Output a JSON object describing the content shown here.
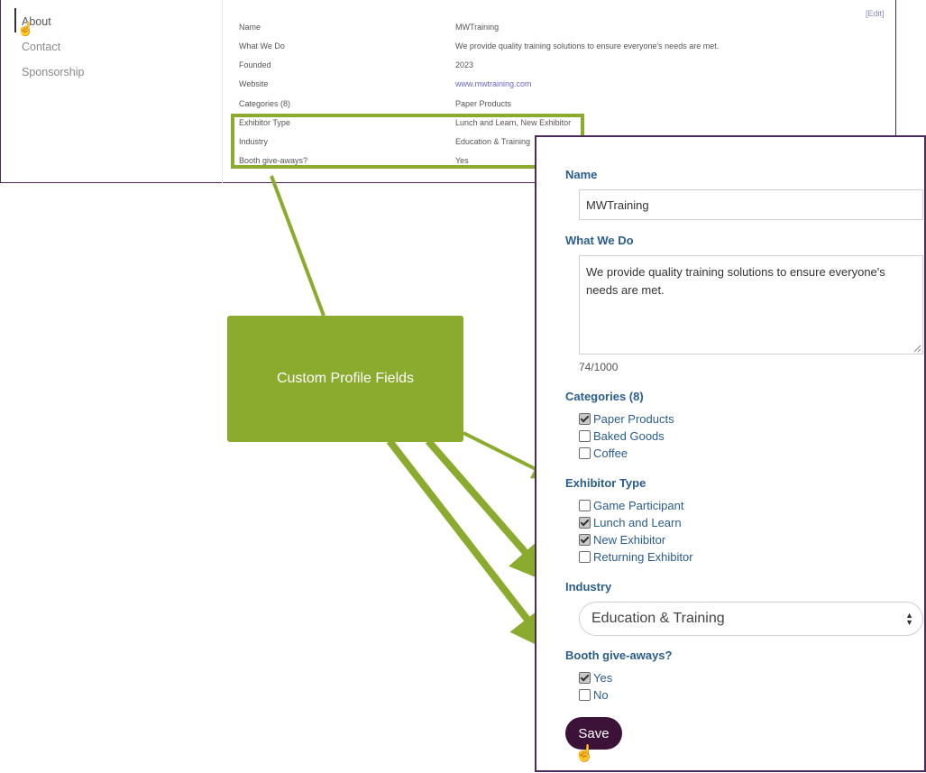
{
  "profile": {
    "nav": [
      {
        "label": "About"
      },
      {
        "label": "Contact"
      },
      {
        "label": "Sponsorship"
      }
    ],
    "edit_link": "[Edit]",
    "rows": [
      {
        "key": "Name",
        "value": "MWTraining"
      },
      {
        "key": "What We Do",
        "value": "We provide quality training solutions to ensure everyone's needs are met."
      },
      {
        "key": "Founded",
        "value": "2023"
      },
      {
        "key": "Website",
        "value": "www.mwtraining.com"
      },
      {
        "key": "Categories (8)",
        "value": "Paper Products"
      },
      {
        "key": "Exhibitor Type",
        "value": "Lunch and Learn, New Exhibitor"
      },
      {
        "key": "Industry",
        "value": "Education & Training"
      },
      {
        "key": "Booth give-aways?",
        "value": "Yes"
      }
    ]
  },
  "callout": {
    "label": "Custom Profile Fields",
    "color": "#8aab2e"
  },
  "form": {
    "name_label": "Name",
    "name_value": "MWTraining",
    "what_label": "What We Do",
    "what_value": "We provide quality training solutions to ensure everyone's needs are met.",
    "char_count": "74/1000",
    "categories_label": "Categories (8)",
    "categories": [
      {
        "label": "Paper Products",
        "checked": true
      },
      {
        "label": "Baked Goods",
        "checked": false
      },
      {
        "label": "Coffee",
        "checked": false
      }
    ],
    "exhibitor_label": "Exhibitor Type",
    "exhibitor_types": [
      {
        "label": "Game Participant",
        "checked": false
      },
      {
        "label": "Lunch and Learn",
        "checked": true
      },
      {
        "label": "New Exhibitor",
        "checked": true
      },
      {
        "label": "Returning Exhibitor",
        "checked": false
      }
    ],
    "industry_label": "Industry",
    "industry_value": "Education & Training",
    "booth_label": "Booth give-aways?",
    "booth_options": [
      {
        "label": "Yes",
        "checked": true
      },
      {
        "label": "No",
        "checked": false
      }
    ],
    "save_label": "Save"
  },
  "colors": {
    "label_blue": "#2a5d8c",
    "save_button": "#3d1238",
    "panel_border": "#4a2a5a",
    "link": "#6a66c8"
  }
}
